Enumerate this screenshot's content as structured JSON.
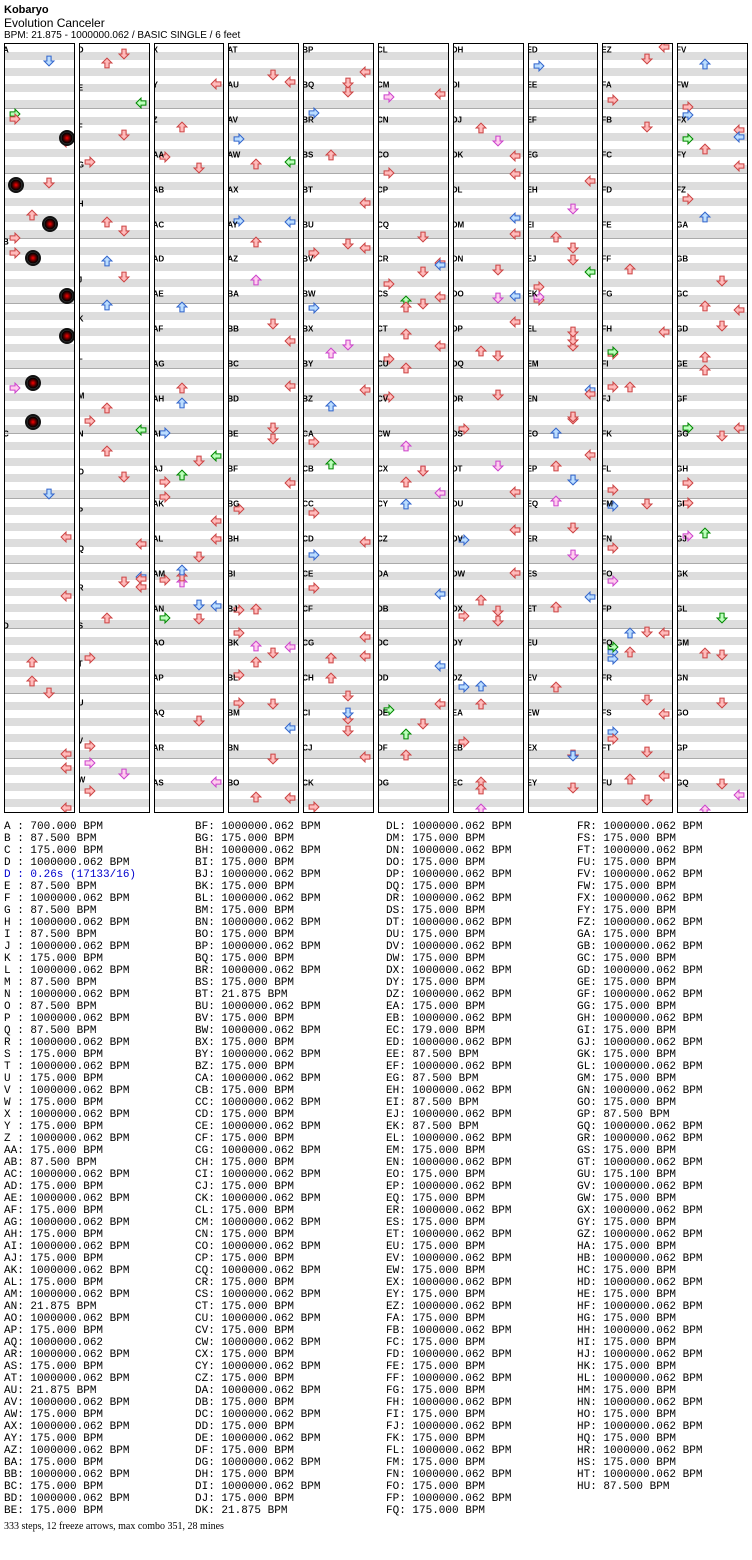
{
  "header": {
    "artist": "Kobaryo",
    "title": "Evolution Canceler",
    "meta": "BPM: 21.875 - 1000000.062 / BASIC SINGLE / 6 feet"
  },
  "footer": "333 steps, 12 freeze arrows, max combo 351, 28 mines",
  "chart_data": {
    "type": "table",
    "columns": 10,
    "lanes": 4,
    "measures_per_column": 12,
    "arrow_colors": {
      "4th": "#f77",
      "8th": "#7af",
      "16th": "#f7f",
      "freeze": "#7f7"
    },
    "mines": 28,
    "steps": 333,
    "freeze_arrows": 12,
    "max_combo": 351
  },
  "bpm": [
    [
      "A",
      "700.000 BPM"
    ],
    [
      "B",
      "87.500 BPM"
    ],
    [
      "C",
      "175.000 BPM"
    ],
    [
      "D",
      "1000000.062 BPM"
    ],
    [
      "D",
      "0.26s (17133/16)",
      "blue"
    ],
    [
      "E",
      "87.500 BPM"
    ],
    [
      "F",
      "1000000.062 BPM"
    ],
    [
      "G",
      "87.500 BPM"
    ],
    [
      "H",
      "1000000.062 BPM"
    ],
    [
      "I",
      "87.500 BPM"
    ],
    [
      "J",
      "1000000.062 BPM"
    ],
    [
      "K",
      "175.000 BPM"
    ],
    [
      "L",
      "1000000.062 BPM"
    ],
    [
      "M",
      "87.500 BPM"
    ],
    [
      "N",
      "1000000.062 BPM"
    ],
    [
      "O",
      "87.500 BPM"
    ],
    [
      "P",
      "1000000.062 BPM"
    ],
    [
      "Q",
      "87.500 BPM"
    ],
    [
      "R",
      "1000000.062 BPM"
    ],
    [
      "S",
      "175.000 BPM"
    ],
    [
      "T",
      "1000000.062 BPM"
    ],
    [
      "U",
      "175.000 BPM"
    ],
    [
      "V",
      "1000000.062 BPM"
    ],
    [
      "W",
      "175.000 BPM"
    ],
    [
      "X",
      "1000000.062 BPM"
    ],
    [
      "Y",
      "175.000 BPM"
    ],
    [
      "Z",
      "1000000.062 BPM"
    ],
    [
      "AA",
      "175.000 BPM"
    ],
    [
      "AB",
      "87.500 BPM"
    ],
    [
      "AC",
      "1000000.062 BPM"
    ],
    [
      "AD",
      "175.000 BPM"
    ],
    [
      "AE",
      "1000000.062 BPM"
    ],
    [
      "AF",
      "175.000 BPM"
    ],
    [
      "AG",
      "1000000.062 BPM"
    ],
    [
      "AH",
      "175.000 BPM"
    ],
    [
      "AI",
      "1000000.062 BPM"
    ],
    [
      "AJ",
      "175.000 BPM"
    ],
    [
      "AK",
      "1000000.062 BPM"
    ],
    [
      "AL",
      "175.000 BPM"
    ],
    [
      "AM",
      "1000000.062 BPM"
    ],
    [
      "AN",
      "21.875 BPM"
    ],
    [
      "AO",
      "1000000.062 BPM"
    ],
    [
      "AP",
      "175.000 BPM"
    ],
    [
      "AQ",
      "1000000.062"
    ],
    [
      "AR",
      "1000000.062 BPM"
    ],
    [
      "AS",
      "175.000 BPM"
    ],
    [
      "AT",
      "1000000.062 BPM"
    ],
    [
      "AU",
      "21.875 BPM"
    ],
    [
      "AV",
      "1000000.062 BPM"
    ],
    [
      "AW",
      "175.000 BPM"
    ],
    [
      "AX",
      "1000000.062 BPM"
    ],
    [
      "AY",
      "175.000 BPM"
    ],
    [
      "AZ",
      "1000000.062 BPM"
    ],
    [
      "BA",
      "175.000 BPM"
    ],
    [
      "BB",
      "1000000.062 BPM"
    ],
    [
      "BC",
      "175.000 BPM"
    ],
    [
      "BD",
      "1000000.062 BPM"
    ],
    [
      "BE",
      "175.000 BPM"
    ],
    [
      "BF",
      "1000000.062 BPM"
    ],
    [
      "BG",
      "175.000 BPM"
    ],
    [
      "BH",
      "1000000.062 BPM"
    ],
    [
      "BI",
      "175.000 BPM"
    ],
    [
      "BJ",
      "1000000.062 BPM"
    ],
    [
      "BK",
      "175.000 BPM"
    ],
    [
      "BL",
      "1000000.062 BPM"
    ],
    [
      "BM",
      "175.000 BPM"
    ],
    [
      "BN",
      "1000000.062 BPM"
    ],
    [
      "BO",
      "175.000 BPM"
    ],
    [
      "BP",
      "1000000.062 BPM"
    ],
    [
      "BQ",
      "175.000 BPM"
    ],
    [
      "BR",
      "1000000.062 BPM"
    ],
    [
      "BS",
      "175.000 BPM"
    ],
    [
      "BT",
      "21.875 BPM"
    ],
    [
      "BU",
      "1000000.062 BPM"
    ],
    [
      "BV",
      "175.000 BPM"
    ],
    [
      "BW",
      "1000000.062 BPM"
    ],
    [
      "BX",
      "175.000 BPM"
    ],
    [
      "BY",
      "1000000.062 BPM"
    ],
    [
      "BZ",
      "175.000 BPM"
    ],
    [
      "CA",
      "1000000.062 BPM"
    ],
    [
      "CB",
      "175.000 BPM"
    ],
    [
      "CC",
      "1000000.062 BPM"
    ],
    [
      "CD",
      "175.000 BPM"
    ],
    [
      "CE",
      "1000000.062 BPM"
    ],
    [
      "CF",
      "175.000 BPM"
    ],
    [
      "CG",
      "1000000.062 BPM"
    ],
    [
      "CH",
      "175.000 BPM"
    ],
    [
      "CI",
      "1000000.062 BPM"
    ],
    [
      "CJ",
      "175.000 BPM"
    ],
    [
      "CK",
      "1000000.062 BPM"
    ],
    [
      "CL",
      "175.000 BPM"
    ],
    [
      "CM",
      "1000000.062 BPM"
    ],
    [
      "CN",
      "175.000 BPM"
    ],
    [
      "CO",
      "1000000.062 BPM"
    ],
    [
      "CP",
      "175.000 BPM"
    ],
    [
      "CQ",
      "1000000.062 BPM"
    ],
    [
      "CR",
      "175.000 BPM"
    ],
    [
      "CS",
      "1000000.062 BPM"
    ],
    [
      "CT",
      "175.000 BPM"
    ],
    [
      "CU",
      "1000000.062 BPM"
    ],
    [
      "CV",
      "175.000 BPM"
    ],
    [
      "CW",
      "1000000.062 BPM"
    ],
    [
      "CX",
      "175.000 BPM"
    ],
    [
      "CY",
      "1000000.062 BPM"
    ],
    [
      "CZ",
      "175.000 BPM"
    ],
    [
      "DA",
      "1000000.062 BPM"
    ],
    [
      "DB",
      "175.000 BPM"
    ],
    [
      "DC",
      "1000000.062 BPM"
    ],
    [
      "DD",
      "175.000 BPM"
    ],
    [
      "DE",
      "1000000.062 BPM"
    ],
    [
      "DF",
      "175.000 BPM"
    ],
    [
      "DG",
      "1000000.062 BPM"
    ],
    [
      "DH",
      "175.000 BPM"
    ],
    [
      "DI",
      "1000000.062 BPM"
    ],
    [
      "DJ",
      "175.000 BPM"
    ],
    [
      "DK",
      "21.875 BPM"
    ],
    [
      "DL",
      "1000000.062 BPM"
    ],
    [
      "DM",
      "175.000 BPM"
    ],
    [
      "DN",
      "1000000.062 BPM"
    ],
    [
      "DO",
      "175.000 BPM"
    ],
    [
      "DP",
      "1000000.062 BPM"
    ],
    [
      "DQ",
      "175.000 BPM"
    ],
    [
      "DR",
      "1000000.062 BPM"
    ],
    [
      "DS",
      "175.000 BPM"
    ],
    [
      "DT",
      "1000000.062 BPM"
    ],
    [
      "DU",
      "175.000 BPM"
    ],
    [
      "DV",
      "1000000.062 BPM"
    ],
    [
      "DW",
      "175.000 BPM"
    ],
    [
      "DX",
      "1000000.062 BPM"
    ],
    [
      "DY",
      "175.000 BPM"
    ],
    [
      "DZ",
      "1000000.062 BPM"
    ],
    [
      "EA",
      "175.000 BPM"
    ],
    [
      "EB",
      "1000000.062 BPM"
    ],
    [
      "EC",
      "179.000 BPM"
    ],
    [
      "ED",
      "1000000.062 BPM"
    ],
    [
      "EE",
      "87.500 BPM"
    ],
    [
      "EF",
      "1000000.062 BPM"
    ],
    [
      "EG",
      "87.500 BPM"
    ],
    [
      "EH",
      "1000000.062 BPM"
    ],
    [
      "EI",
      "87.500 BPM"
    ],
    [
      "EJ",
      "1000000.062 BPM"
    ],
    [
      "EK",
      "87.500 BPM"
    ],
    [
      "EL",
      "1000000.062 BPM"
    ],
    [
      "EM",
      "175.000 BPM"
    ],
    [
      "EN",
      "1000000.062 BPM"
    ],
    [
      "EO",
      "175.000 BPM"
    ],
    [
      "EP",
      "1000000.062 BPM"
    ],
    [
      "EQ",
      "175.000 BPM"
    ],
    [
      "ER",
      "1000000.062 BPM"
    ],
    [
      "ES",
      "175.000 BPM"
    ],
    [
      "ET",
      "1000000.062 BPM"
    ],
    [
      "EU",
      "175.000 BPM"
    ],
    [
      "EV",
      "1000000.062 BPM"
    ],
    [
      "EW",
      "175.000 BPM"
    ],
    [
      "EX",
      "1000000.062 BPM"
    ],
    [
      "EY",
      "175.000 BPM"
    ],
    [
      "EZ",
      "1000000.062 BPM"
    ],
    [
      "FA",
      "175.000 BPM"
    ],
    [
      "FB",
      "1000000.062 BPM"
    ],
    [
      "FC",
      "175.000 BPM"
    ],
    [
      "FD",
      "1000000.062 BPM"
    ],
    [
      "FE",
      "175.000 BPM"
    ],
    [
      "FF",
      "1000000.062 BPM"
    ],
    [
      "FG",
      "175.000 BPM"
    ],
    [
      "FH",
      "1000000.062 BPM"
    ],
    [
      "FI",
      "175.000 BPM"
    ],
    [
      "FJ",
      "1000000.062 BPM"
    ],
    [
      "FK",
      "175.000 BPM"
    ],
    [
      "FL",
      "1000000.062 BPM"
    ],
    [
      "FM",
      "175.000 BPM"
    ],
    [
      "FN",
      "1000000.062 BPM"
    ],
    [
      "FO",
      "175.000 BPM"
    ],
    [
      "FP",
      "1000000.062 BPM"
    ],
    [
      "FQ",
      "175.000 BPM"
    ],
    [
      "FR",
      "1000000.062 BPM"
    ],
    [
      "FS",
      "175.000 BPM"
    ],
    [
      "FT",
      "1000000.062 BPM"
    ],
    [
      "FU",
      "175.000 BPM"
    ],
    [
      "FV",
      "1000000.062 BPM"
    ],
    [
      "FW",
      "175.000 BPM"
    ],
    [
      "FX",
      "1000000.062 BPM"
    ],
    [
      "FY",
      "175.000 BPM"
    ],
    [
      "FZ",
      "1000000.062 BPM"
    ],
    [
      "GA",
      "175.000 BPM"
    ],
    [
      "GB",
      "1000000.062 BPM"
    ],
    [
      "GC",
      "175.000 BPM"
    ],
    [
      "GD",
      "1000000.062 BPM"
    ],
    [
      "GE",
      "175.000 BPM"
    ],
    [
      "GF",
      "1000000.062 BPM"
    ],
    [
      "GG",
      "175.000 BPM"
    ],
    [
      "GH",
      "1000000.062 BPM"
    ],
    [
      "GI",
      "175.000 BPM"
    ],
    [
      "GJ",
      "1000000.062 BPM"
    ],
    [
      "GK",
      "175.000 BPM"
    ],
    [
      "GL",
      "1000000.062 BPM"
    ],
    [
      "GM",
      "175.000 BPM"
    ],
    [
      "GN",
      "1000000.062 BPM"
    ],
    [
      "GO",
      "175.000 BPM"
    ],
    [
      "GP",
      "87.500 BPM"
    ],
    [
      "GQ",
      "1000000.062 BPM"
    ],
    [
      "GR",
      "1000000.062 BPM"
    ],
    [
      "GS",
      "175.000 BPM"
    ],
    [
      "GT",
      "1000000.062 BPM"
    ],
    [
      "GU",
      "175.100 BPM"
    ],
    [
      "GV",
      "1000000.062 BPM"
    ],
    [
      "GW",
      "175.000 BPM"
    ],
    [
      "GX",
      "1000000.062 BPM"
    ],
    [
      "GY",
      "175.000 BPM"
    ],
    [
      "GZ",
      "1000000.062 BPM"
    ],
    [
      "HA",
      "175.000 BPM"
    ],
    [
      "HB",
      "1000000.062 BPM"
    ],
    [
      "HC",
      "175.000 BPM"
    ],
    [
      "HD",
      "1000000.062 BPM"
    ],
    [
      "HE",
      "175.000 BPM"
    ],
    [
      "HF",
      "1000000.062 BPM"
    ],
    [
      "HG",
      "175.000 BPM"
    ],
    [
      "HH",
      "1000000.062 BPM"
    ],
    [
      "HI",
      "175.000 BPM"
    ],
    [
      "HJ",
      "1000000.062 BPM"
    ],
    [
      "HK",
      "175.000 BPM"
    ],
    [
      "HL",
      "1000000.062 BPM"
    ],
    [
      "HM",
      "175.000 BPM"
    ],
    [
      "HN",
      "1000000.062 BPM"
    ],
    [
      "HO",
      "175.000 BPM"
    ],
    [
      "HP",
      "1000000.062 BPM"
    ],
    [
      "HQ",
      "175.000 BPM"
    ],
    [
      "HR",
      "1000000.062 BPM"
    ],
    [
      "HS",
      "175.000 BPM"
    ],
    [
      "HT",
      "1000000.062 BPM"
    ],
    [
      "HU",
      "87.500 BPM"
    ]
  ]
}
